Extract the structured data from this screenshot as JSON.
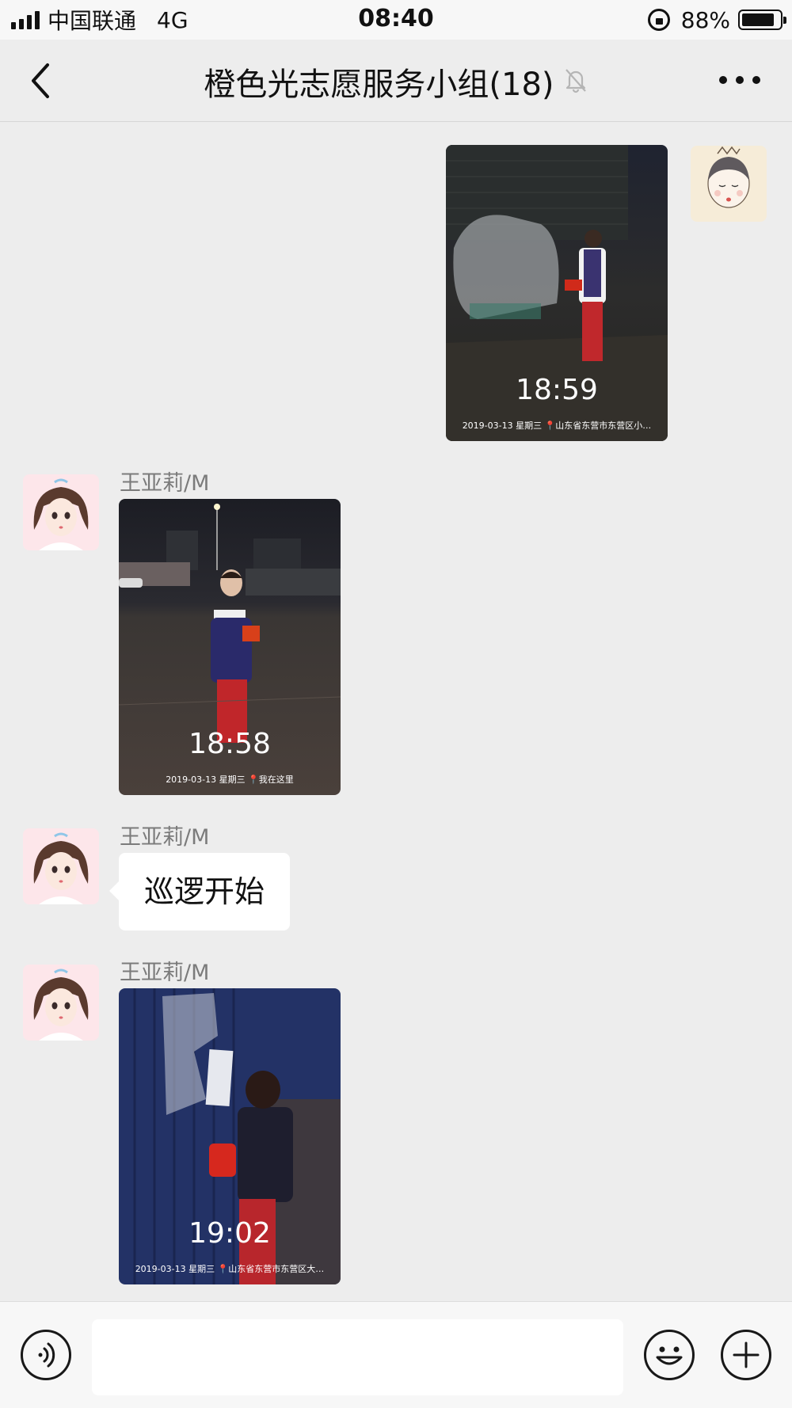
{
  "status_bar": {
    "carrier": "中国联通",
    "network": "4G",
    "time": "08:40",
    "battery_percent": "88%",
    "battery_level": 0.88,
    "icons": [
      "signal-icon",
      "rotation-lock-icon",
      "battery-icon"
    ]
  },
  "nav": {
    "title": "橙色光志愿服务小组(18)",
    "icons": [
      "back-arrow-icon",
      "mute-bell-icon",
      "more-icon"
    ]
  },
  "messages": [
    {
      "type": "image",
      "direction": "outgoing",
      "sender": "",
      "photo_time": "18:59",
      "photo_caption": "2019-03-13  星期三 📍山东省东营市东营区小…"
    },
    {
      "type": "image",
      "direction": "incoming",
      "sender": "王亚莉/M",
      "photo_time": "18:58",
      "photo_caption": "2019-03-13  星期三 📍我在这里"
    },
    {
      "type": "text",
      "direction": "incoming",
      "sender": "王亚莉/M",
      "text": "巡逻开始"
    },
    {
      "type": "image",
      "direction": "incoming",
      "sender": "王亚莉/M",
      "photo_time": "19:02",
      "photo_caption": "2019-03-13  星期三 📍山东省东营市东营区大…"
    }
  ],
  "input_bar": {
    "value": "",
    "icons": [
      "voice-icon",
      "emoji-icon",
      "plus-icon"
    ]
  },
  "colors": {
    "background": "#ededed",
    "bubble": "#ffffff",
    "sender_name": "#7b7b7b"
  }
}
